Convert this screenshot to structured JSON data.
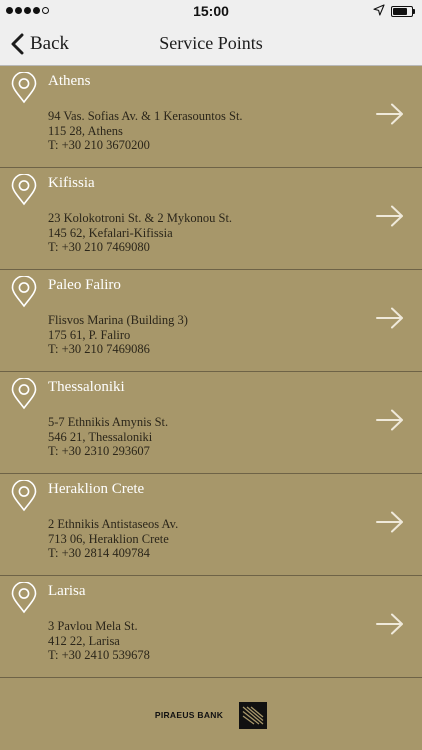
{
  "status_bar": {
    "time": "15:00",
    "signal_dots_filled": 4,
    "signal_dots_total": 5,
    "battery_level": 0.75
  },
  "nav": {
    "back_label": "Back",
    "title": "Service Points"
  },
  "service_points": [
    {
      "city": "Athens",
      "address": "94 Vas. Sofias Av. & 1 Kerasountos St.",
      "postal": "115 28, Athens",
      "phone": "T: +30 210 3670200"
    },
    {
      "city": "Kifissia",
      "address": "23 Kolokotroni St. & 2 Mykonou St.",
      "postal": "145 62, Kefalari-Kifissia",
      "phone": "T: +30 210 7469080"
    },
    {
      "city": "Paleo Faliro",
      "address": "Flisvos Marina (Building 3)",
      "postal": "175 61, P. Faliro",
      "phone": "T: +30 210 7469086"
    },
    {
      "city": "Thessaloniki",
      "address": "5-7 Ethnikis Amynis St.",
      "postal": "546 21, Thessaloniki",
      "phone": "T: +30 2310 293607"
    },
    {
      "city": "Heraklion Crete",
      "address": "2 Ethnikis Antistaseos Av.",
      "postal": "713 06, Heraklion Crete",
      "phone": "T: +30 2814 409784"
    },
    {
      "city": "Larisa",
      "address": "3 Pavlou Mela St.",
      "postal": "412 22, Larisa",
      "phone": "T: +30 2410 539678"
    }
  ],
  "footer": {
    "logo_text": "PIRAEUS BANK"
  },
  "colors": {
    "background": "#a7976a",
    "bar": "#efefef",
    "divider": "#6e6347",
    "city_text": "#ffffff",
    "address_text": "#2b261a"
  },
  "icons": {
    "pin": "location-pin-icon",
    "arrow": "arrow-right-icon",
    "back": "chevron-left-icon",
    "location": "location-arrow-icon",
    "battery": "battery-icon",
    "logo": "piraeus-logo-icon"
  }
}
